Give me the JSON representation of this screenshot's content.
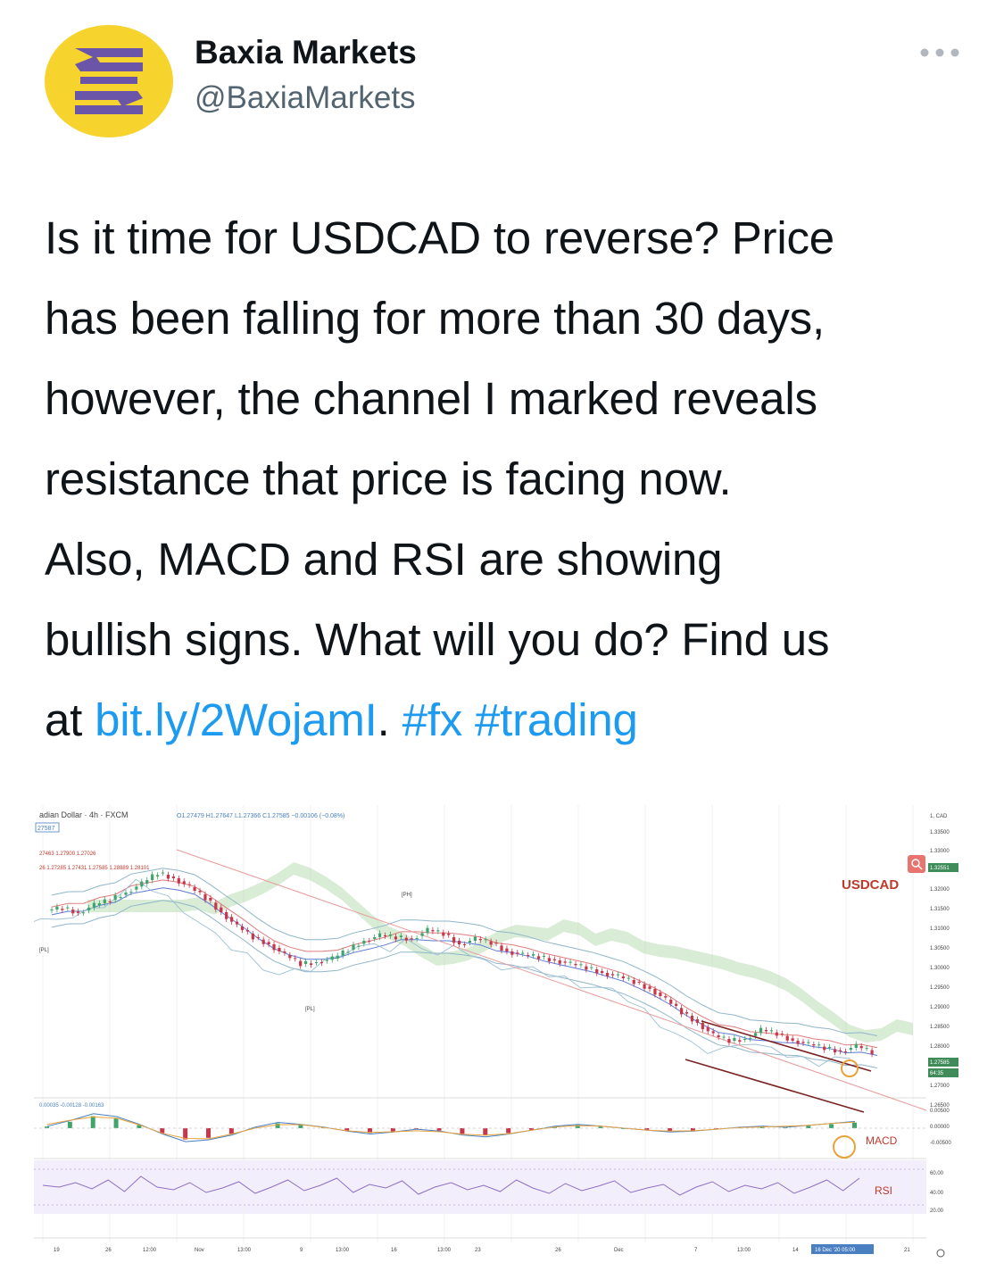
{
  "author": {
    "name": "Baxia Markets",
    "handle": "@BaxiaMarkets",
    "avatar_icon": "baxia-logo-icon"
  },
  "menu_icon": "more-horizontal-icon",
  "tweet": {
    "line1": "Is it time for USDCAD to reverse? Price",
    "line2": "has been falling for more than 30 days,",
    "line3": "however, the channel I marked reveals",
    "line4": "resistance that price is facing now.",
    "line5": "Also, MACD and RSI are showing",
    "line6": "bullish signs. What will you do? Find us",
    "line7_prefix": "at ",
    "link": "bit.ly/2WojamI",
    "link_suffix": ". ",
    "hashtag1": "#fx",
    "hashtag2": "#trading"
  },
  "colors": {
    "link": "#1d9bf0",
    "avatar_bg": "#f6d32d",
    "avatar_mark": "#6a55a8",
    "annotation": "#c0392b"
  },
  "chart_data": {
    "type": "line",
    "header": {
      "symbol": "adian Dollar · 4h · FXCM",
      "ohlc": "O1.27479 H1.27647 L1.27366 C1.27585 −0.00106 (−0.08%)",
      "price_box": "27587",
      "line_a": "27463  1.27900  1.27026",
      "line_b": "26  1.27285  1.27431  1.27585  1.28889  1.28101"
    },
    "labels": {
      "usdcad": "USDCAD",
      "macd": "MACD",
      "rsi": "RSI",
      "macd_values": "0.00035  -0.00128  -0.00163",
      "pl_1": "[PL]",
      "pl_2": "[PL]",
      "ph": "[PH]"
    },
    "y_axis_top": "1, CAD",
    "y_ticks": [
      "1.33500",
      "1.33000",
      "1.32551",
      "1.32000",
      "1.31500",
      "1.31000",
      "1.30500",
      "1.30000",
      "1.29500",
      "1.29000",
      "1.28500",
      "1.28000",
      "1.27585",
      "64:35",
      "1.27000",
      "1.26500"
    ],
    "macd_ticks": [
      "0.00500",
      "0.00000",
      "-0.00500"
    ],
    "rsi_ticks": [
      "60.00",
      "40.00",
      "20.00"
    ],
    "x_ticks": [
      "19",
      "26",
      "12:00",
      "Nov",
      "13:00",
      "9",
      "13:00",
      "16",
      "13:00",
      "23",
      "26",
      "Dec",
      "7",
      "13:00",
      "14",
      "16 Dec '20  05:00",
      "21"
    ],
    "price_series": [
      1.3155,
      1.3162,
      1.3148,
      1.317,
      1.3185,
      1.3205,
      1.323,
      1.326,
      1.3245,
      1.322,
      1.319,
      1.315,
      1.311,
      1.308,
      1.306,
      1.303,
      1.3005,
      1.301,
      1.302,
      1.3045,
      1.307,
      1.3085,
      1.308,
      1.3075,
      1.31,
      1.309,
      1.306,
      1.3075,
      1.3065,
      1.304,
      1.303,
      1.3025,
      1.3015,
      1.3005,
      1.2995,
      1.298,
      1.297,
      1.2955,
      1.2935,
      1.2905,
      1.287,
      1.284,
      1.2805,
      1.279,
      1.2795,
      1.282,
      1.281,
      1.279,
      1.278,
      1.277,
      1.276,
      1.2775,
      1.2758
    ],
    "rsi_series": [
      52,
      50,
      55,
      48,
      58,
      45,
      62,
      50,
      47,
      55,
      44,
      49,
      56,
      43,
      50,
      58,
      46,
      52,
      60,
      44,
      53,
      49,
      57,
      42,
      50,
      55,
      47,
      52,
      45,
      58,
      49,
      43,
      54,
      46,
      51,
      57,
      44,
      49,
      53,
      41,
      50,
      56,
      45,
      52,
      48,
      55,
      43,
      50,
      58,
      46,
      60
    ],
    "macd_series": [
      0.0002,
      0.0008,
      0.0015,
      0.0012,
      0.0004,
      -0.0006,
      -0.0014,
      -0.0012,
      -0.0007,
      0.0001,
      0.0006,
      0.0004,
      0.0001,
      -0.0003,
      -0.0006,
      -0.0004,
      -0.0001,
      -0.0003,
      -0.0007,
      -0.0009,
      -0.0006,
      -0.0002,
      0.0002,
      0.0004,
      0.0002,
      0.0,
      -0.0002,
      -0.0004,
      -0.0003,
      -0.0001,
      0.0001,
      0.0002,
      0.0001,
      0.0003,
      0.0005,
      0.0007
    ],
    "ylim": [
      1.265,
      1.3375
    ]
  }
}
